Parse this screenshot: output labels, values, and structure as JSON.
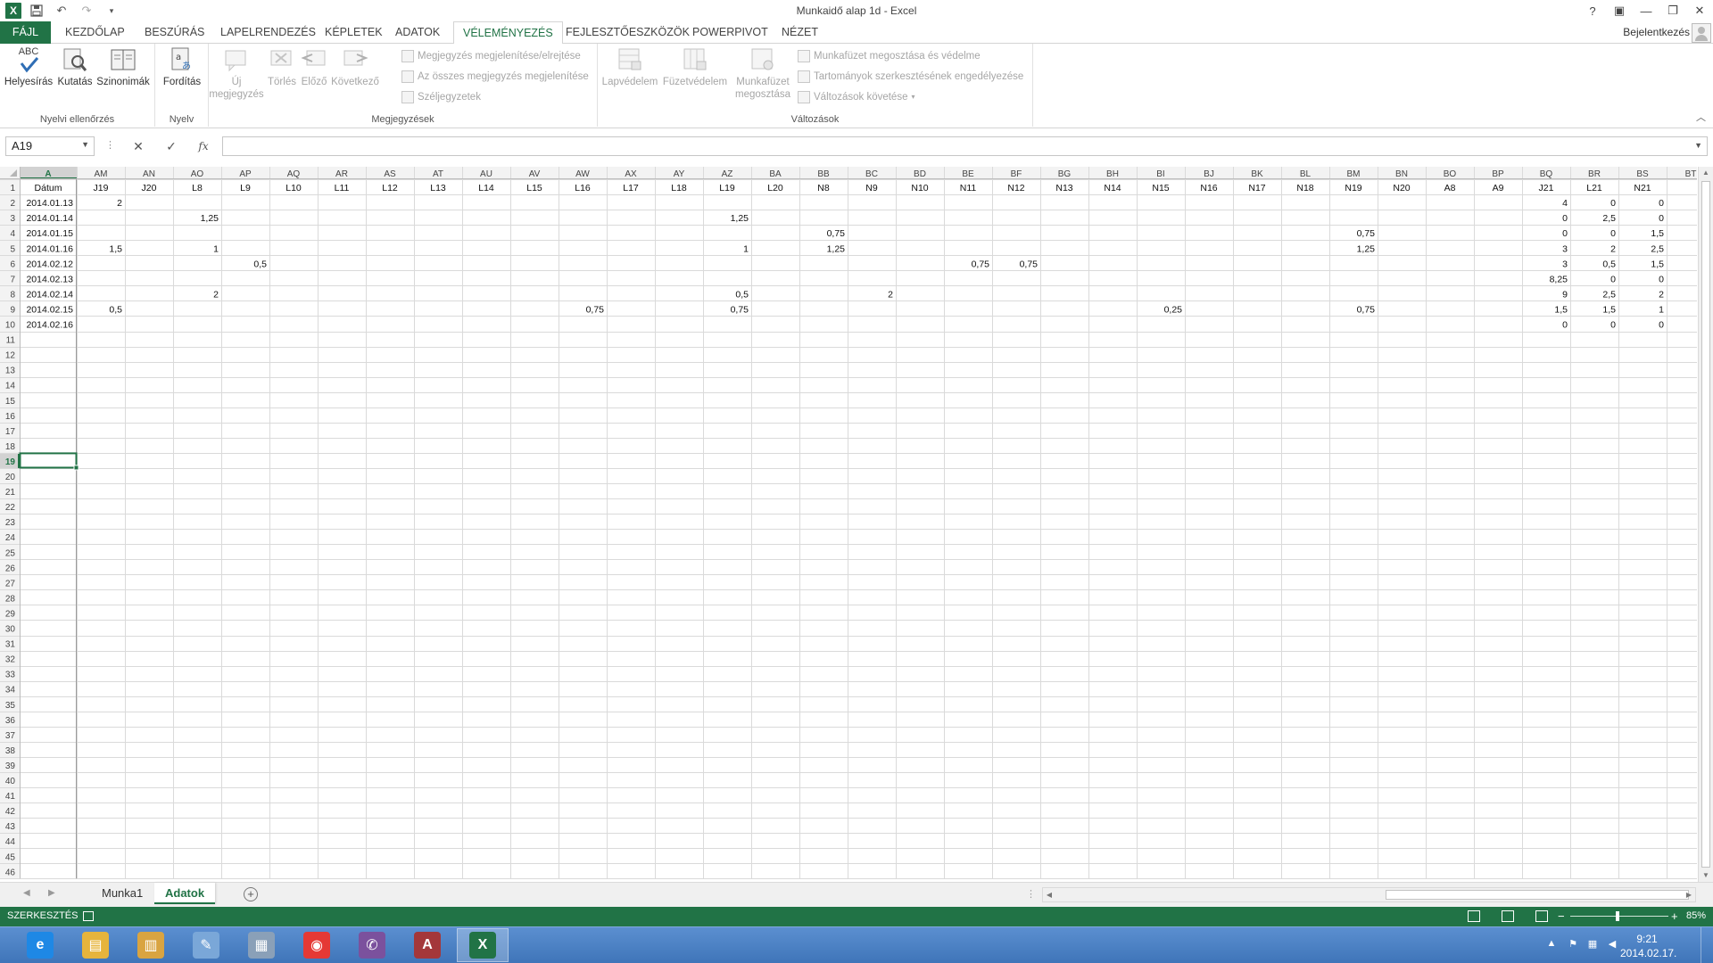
{
  "window": {
    "title": "Munkaidő alap 1d - Excel"
  },
  "window_controls": {
    "help": "?",
    "restore_ribbon": "▣",
    "minimize": "—",
    "maximize": "❐",
    "close": "✕"
  },
  "ribbon_tabs": [
    "FÁJL",
    "KEZDŐLAP",
    "BESZÚRÁS",
    "LAPELRENDEZÉS",
    "KÉPLETEK",
    "ADATOK",
    "VÉLEMÉNYEZÉS",
    "FEJLESZTŐESZKÖZÖK",
    "POWERPIVOT",
    "NÉZET"
  ],
  "active_tab": "VÉLEMÉNYEZÉS",
  "account": {
    "signin": "Bejelentkezés"
  },
  "ribbon": {
    "proofing": {
      "label": "Nyelvi ellenőrzés",
      "spelling_top": "ABC",
      "spelling": "Helyesírás",
      "research": "Kutatás",
      "thesaurus": "Szinonimák"
    },
    "language": {
      "label": "Nyelv",
      "translate": "Fordítás"
    },
    "comments": {
      "label": "Megjegyzések",
      "new_comment_1": "Új",
      "new_comment_2": "megjegyzés",
      "delete": "Törlés",
      "previous": "Előző",
      "next": "Következő",
      "show_hide": "Megjegyzés megjelenítése/elrejtése",
      "show_all": "Az összes megjegyzés megjelenítése",
      "ink": "Széljegyzetek"
    },
    "changes": {
      "label": "Változások",
      "protect_sheet": "Lapvédelem",
      "protect_workbook": "Füzetvédelem",
      "share_workbook_1": "Munkafüzet",
      "share_workbook_2": "megosztása",
      "protect_share": "Munkafüzet megosztása és védelme",
      "allow_ranges": "Tartományok szerkesztésének engedélyezése",
      "track_changes": "Változások követése"
    }
  },
  "formula_bar": {
    "name_box": "A19",
    "fx": "fx",
    "cancel": "✕",
    "enter": "✓",
    "formula": ""
  },
  "grid": {
    "columns": [
      "A",
      "AM",
      "AN",
      "AO",
      "AP",
      "AQ",
      "AR",
      "AS",
      "AT",
      "AU",
      "AV",
      "AW",
      "AX",
      "AY",
      "AZ",
      "BA",
      "BB",
      "BC",
      "BD",
      "BE",
      "BF",
      "BG",
      "BH",
      "BI",
      "BJ",
      "BK",
      "BL",
      "BM",
      "BN",
      "BO",
      "BP",
      "BQ",
      "BR",
      "BS",
      "BT"
    ],
    "row_count": 46,
    "selected_cell": {
      "col": "A",
      "row": 19
    },
    "rows": {
      "1": [
        "Dátum",
        "J19",
        "J20",
        "L8",
        "L9",
        "L10",
        "L11",
        "L12",
        "L13",
        "L14",
        "L15",
        "L16",
        "L17",
        "L18",
        "L19",
        "L20",
        "N8",
        "N9",
        "N10",
        "N11",
        "N12",
        "N13",
        "N14",
        "N15",
        "N16",
        "N17",
        "N18",
        "N19",
        "N20",
        "A8",
        "A9",
        "J21",
        "L21",
        "N21",
        ""
      ],
      "2": [
        "2014.01.13",
        "2",
        "",
        "",
        "",
        "",
        "",
        "",
        "",
        "",
        "",
        "",
        "",
        "",
        "",
        "",
        "",
        "",
        "",
        "",
        "",
        "",
        "",
        "",
        "",
        "",
        "",
        "",
        "",
        "",
        "",
        "4",
        "0",
        "0",
        ""
      ],
      "3": [
        "2014.01.14",
        "",
        "",
        "1,25",
        "",
        "",
        "",
        "",
        "",
        "",
        "",
        "",
        "",
        "",
        "1,25",
        "",
        "",
        "",
        "",
        "",
        "",
        "",
        "",
        "",
        "",
        "",
        "",
        "",
        "",
        "",
        "",
        "0",
        "2,5",
        "0",
        ""
      ],
      "4": [
        "2014.01.15",
        "",
        "",
        "",
        "",
        "",
        "",
        "",
        "",
        "",
        "",
        "",
        "",
        "",
        "",
        "",
        "0,75",
        "",
        "",
        "",
        "",
        "",
        "",
        "",
        "",
        "",
        "",
        "0,75",
        "",
        "",
        "",
        "0",
        "0",
        "1,5",
        ""
      ],
      "5": [
        "2014.01.16",
        "1,5",
        "",
        "1",
        "",
        "",
        "",
        "",
        "",
        "",
        "",
        "",
        "",
        "",
        "1",
        "",
        "1,25",
        "",
        "",
        "",
        "",
        "",
        "",
        "",
        "",
        "",
        "",
        "1,25",
        "",
        "",
        "",
        "3",
        "2",
        "2,5",
        ""
      ],
      "6": [
        "2014.02.12",
        "",
        "",
        "",
        "0,5",
        "",
        "",
        "",
        "",
        "",
        "",
        "",
        "",
        "",
        "",
        "",
        "",
        "",
        "",
        "0,75",
        "0,75",
        "",
        "",
        "",
        "",
        "",
        "",
        "",
        "",
        "",
        "",
        "3",
        "0,5",
        "1,5",
        ""
      ],
      "7": [
        "2014.02.13",
        "",
        "",
        "",
        "",
        "",
        "",
        "",
        "",
        "",
        "",
        "",
        "",
        "",
        "",
        "",
        "",
        "",
        "",
        "",
        "",
        "",
        "",
        "",
        "",
        "",
        "",
        "",
        "",
        "",
        "",
        "8,25",
        "0",
        "0",
        ""
      ],
      "8": [
        "2014.02.14",
        "",
        "",
        "2",
        "",
        "",
        "",
        "",
        "",
        "",
        "",
        "",
        "",
        "",
        "0,5",
        "",
        "",
        "2",
        "",
        "",
        "",
        "",
        "",
        "",
        "",
        "",
        "",
        "",
        "",
        "",
        "",
        "9",
        "2,5",
        "2",
        ""
      ],
      "9": [
        "2014.02.15",
        "0,5",
        "",
        "",
        "",
        "",
        "",
        "",
        "",
        "",
        "",
        "0,75",
        "",
        "",
        "0,75",
        "",
        "",
        "",
        "",
        "",
        "",
        "",
        "",
        "0,25",
        "",
        "",
        "",
        "0,75",
        "",
        "",
        "",
        "1,5",
        "1,5",
        "1",
        ""
      ],
      "10": [
        "2014.02.16",
        "",
        "",
        "",
        "",
        "",
        "",
        "",
        "",
        "",
        "",
        "",
        "",
        "",
        "",
        "",
        "",
        "",
        "",
        "",
        "",
        "",
        "",
        "",
        "",
        "",
        "",
        "",
        "",
        "",
        "",
        "0",
        "0",
        "0",
        ""
      ]
    }
  },
  "sheet_tabs": [
    "Munka1",
    "Adatok"
  ],
  "active_sheet": "Adatok",
  "status": {
    "mode": "SZERKESZTÉS",
    "zoom": "85%",
    "zoom_minus": "−",
    "zoom_plus": "+"
  },
  "taskbar": {
    "apps": [
      {
        "name": "internet-explorer",
        "glyph": "e",
        "color": "#1e88e5"
      },
      {
        "name": "file-explorer",
        "glyph": "▤",
        "color": "#e6b43c"
      },
      {
        "name": "file-manager",
        "glyph": "▥",
        "color": "#d9a441"
      },
      {
        "name": "paint",
        "glyph": "✎",
        "color": "#7aa7d8"
      },
      {
        "name": "calculator",
        "glyph": "▦",
        "color": "#8aa0b8"
      },
      {
        "name": "chrome",
        "glyph": "◉",
        "color": "#e53935"
      },
      {
        "name": "viber",
        "glyph": "✆",
        "color": "#7b519d"
      },
      {
        "name": "access",
        "glyph": "A",
        "color": "#a4373a"
      },
      {
        "name": "excel",
        "glyph": "X",
        "color": "#217346"
      }
    ],
    "active_app": "excel",
    "clock_time": "9:21",
    "clock_date": "2014.02.17."
  }
}
